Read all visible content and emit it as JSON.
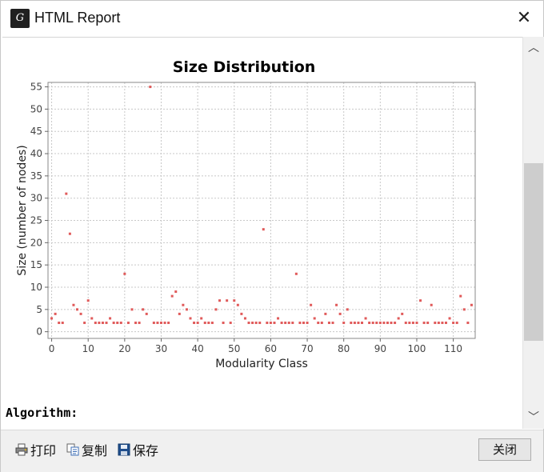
{
  "window": {
    "title": "HTML Report",
    "close_glyph": "✕",
    "icon": "gephi-app-icon"
  },
  "chart_data": {
    "type": "scatter",
    "title": "Size Distribution",
    "xlabel": "Modularity Class",
    "ylabel": "Size (number of nodes)",
    "xlim": [
      -1,
      116
    ],
    "ylim": [
      -1.5,
      56
    ],
    "x_ticks": [
      "0",
      "10",
      "20",
      "30",
      "40",
      "50",
      "60",
      "70",
      "80",
      "90",
      "100",
      "110"
    ],
    "y_ticks": [
      "0",
      "5",
      "10",
      "15",
      "20",
      "25",
      "30",
      "35",
      "40",
      "45",
      "50",
      "55"
    ],
    "x_tick_values": [
      0,
      10,
      20,
      30,
      40,
      50,
      60,
      70,
      80,
      90,
      100,
      110
    ],
    "y_tick_values": [
      0,
      5,
      10,
      15,
      20,
      25,
      30,
      35,
      40,
      45,
      50,
      55
    ],
    "grid": true,
    "marker_color": "#e05a5a",
    "series": [
      {
        "points": [
          [
            0,
            3
          ],
          [
            1,
            4
          ],
          [
            2,
            2
          ],
          [
            3,
            2
          ],
          [
            4,
            31
          ],
          [
            5,
            22
          ],
          [
            6,
            6
          ],
          [
            7,
            5
          ],
          [
            8,
            4
          ],
          [
            9,
            2
          ],
          [
            10,
            7
          ],
          [
            11,
            3
          ],
          [
            12,
            2
          ],
          [
            13,
            2
          ],
          [
            14,
            2
          ],
          [
            15,
            2
          ],
          [
            16,
            3
          ],
          [
            17,
            2
          ],
          [
            18,
            2
          ],
          [
            19,
            2
          ],
          [
            20,
            13
          ],
          [
            21,
            2
          ],
          [
            22,
            5
          ],
          [
            23,
            2
          ],
          [
            24,
            2
          ],
          [
            25,
            5
          ],
          [
            26,
            4
          ],
          [
            27,
            55
          ],
          [
            28,
            2
          ],
          [
            29,
            2
          ],
          [
            30,
            2
          ],
          [
            31,
            2
          ],
          [
            32,
            2
          ],
          [
            33,
            8
          ],
          [
            34,
            9
          ],
          [
            35,
            4
          ],
          [
            36,
            6
          ],
          [
            37,
            5
          ],
          [
            38,
            3
          ],
          [
            39,
            2
          ],
          [
            40,
            2
          ],
          [
            41,
            3
          ],
          [
            42,
            2
          ],
          [
            43,
            2
          ],
          [
            44,
            2
          ],
          [
            45,
            5
          ],
          [
            46,
            7
          ],
          [
            47,
            2
          ],
          [
            48,
            7
          ],
          [
            49,
            2
          ],
          [
            50,
            7
          ],
          [
            51,
            6
          ],
          [
            52,
            4
          ],
          [
            53,
            3
          ],
          [
            54,
            2
          ],
          [
            55,
            2
          ],
          [
            56,
            2
          ],
          [
            57,
            2
          ],
          [
            58,
            23
          ],
          [
            59,
            2
          ],
          [
            60,
            2
          ],
          [
            61,
            2
          ],
          [
            62,
            3
          ],
          [
            63,
            2
          ],
          [
            64,
            2
          ],
          [
            65,
            2
          ],
          [
            66,
            2
          ],
          [
            67,
            13
          ],
          [
            68,
            2
          ],
          [
            69,
            2
          ],
          [
            70,
            2
          ],
          [
            71,
            6
          ],
          [
            72,
            3
          ],
          [
            73,
            2
          ],
          [
            74,
            2
          ],
          [
            75,
            4
          ],
          [
            76,
            2
          ],
          [
            77,
            2
          ],
          [
            78,
            6
          ],
          [
            79,
            4
          ],
          [
            80,
            2
          ],
          [
            81,
            5
          ],
          [
            82,
            2
          ],
          [
            83,
            2
          ],
          [
            84,
            2
          ],
          [
            85,
            2
          ],
          [
            86,
            3
          ],
          [
            87,
            2
          ],
          [
            88,
            2
          ],
          [
            89,
            2
          ],
          [
            90,
            2
          ],
          [
            91,
            2
          ],
          [
            92,
            2
          ],
          [
            93,
            2
          ],
          [
            94,
            2
          ],
          [
            95,
            3
          ],
          [
            96,
            4
          ],
          [
            97,
            2
          ],
          [
            98,
            2
          ],
          [
            99,
            2
          ],
          [
            100,
            2
          ],
          [
            101,
            7
          ],
          [
            102,
            2
          ],
          [
            103,
            2
          ],
          [
            104,
            6
          ],
          [
            105,
            2
          ],
          [
            106,
            2
          ],
          [
            107,
            2
          ],
          [
            108,
            2
          ],
          [
            109,
            3
          ],
          [
            110,
            2
          ],
          [
            111,
            2
          ],
          [
            112,
            8
          ],
          [
            113,
            5
          ],
          [
            114,
            2
          ],
          [
            115,
            6
          ]
        ]
      }
    ]
  },
  "report": {
    "algorithm_label": "Algorithm:"
  },
  "toolbar": {
    "print_label": "打印",
    "copy_label": "复制",
    "save_label": "保存",
    "close_label": "关闭"
  },
  "scrollbar": {
    "up_glyph": "︿",
    "down_glyph": "﹀"
  }
}
